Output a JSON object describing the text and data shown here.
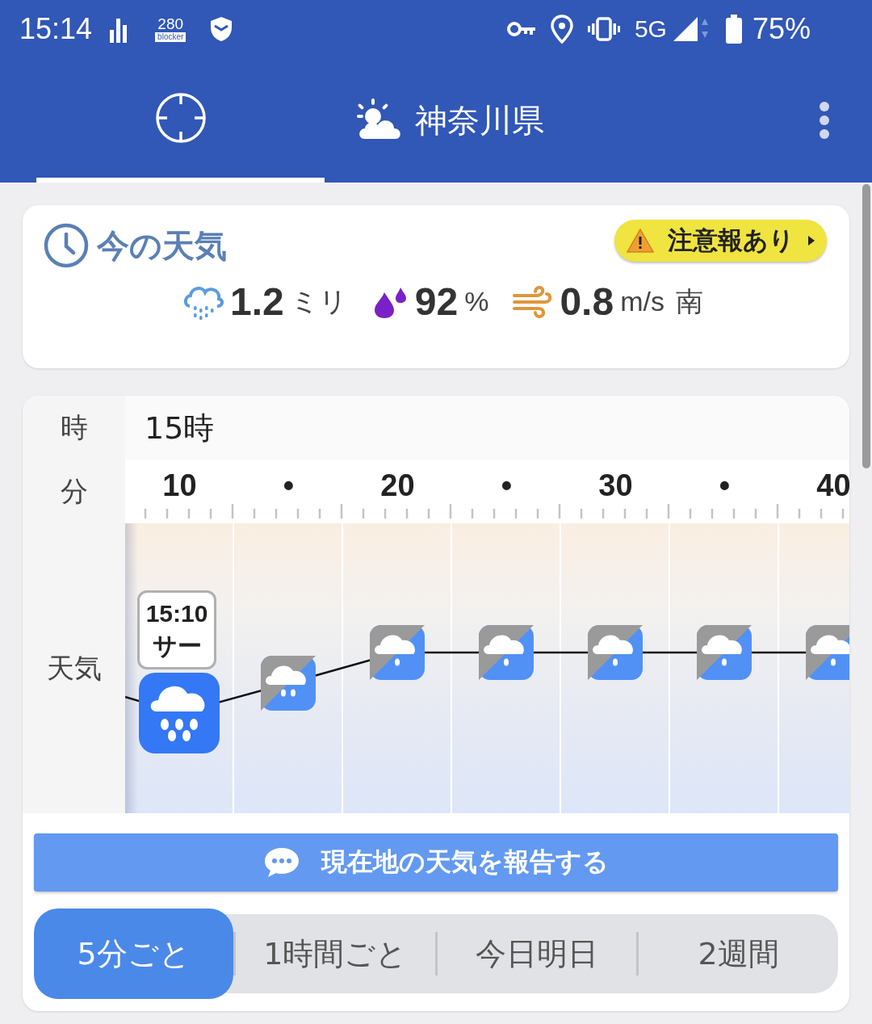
{
  "status_bar": {
    "time": "15:14",
    "blocker_count": "280",
    "blocker_label": "blocker",
    "network": "5G",
    "battery": "75%"
  },
  "header": {
    "tabs": [
      {
        "kind": "location",
        "selected": true
      },
      {
        "kind": "place",
        "label": "神奈川県",
        "selected": false
      }
    ]
  },
  "current": {
    "title": "今の天気",
    "alert": "注意報あり",
    "precipitation": {
      "value": "1.2",
      "unit": "ミリ"
    },
    "humidity": {
      "value": "92",
      "unit": "%"
    },
    "wind": {
      "value": "0.8",
      "unit": "m/s",
      "direction": "南"
    }
  },
  "timeline": {
    "hour_label": "時",
    "hour": "15時",
    "minute_label": "分",
    "weather_label": "天気",
    "minutes": [
      "10",
      "•",
      "20",
      "•",
      "30",
      "•",
      "40"
    ],
    "slots": [
      {
        "kind": "heavy-rain",
        "selected": true,
        "time": "15:10",
        "sound": "サー"
      },
      {
        "kind": "rain",
        "selected": false
      },
      {
        "kind": "light-rain",
        "selected": false
      },
      {
        "kind": "light-rain",
        "selected": false
      },
      {
        "kind": "light-rain",
        "selected": false
      },
      {
        "kind": "light-rain",
        "selected": false
      },
      {
        "kind": "light-rain",
        "selected": false
      }
    ]
  },
  "report_button": "現在地の天気を報告する",
  "range_tabs": [
    {
      "label": "5分ごと",
      "selected": true
    },
    {
      "label": "1時間ごと",
      "selected": false
    },
    {
      "label": "今日明日",
      "selected": false
    },
    {
      "label": "2週間",
      "selected": false
    }
  ]
}
